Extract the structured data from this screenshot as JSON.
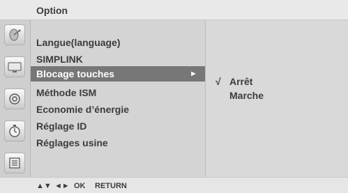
{
  "title": "Option",
  "menu": {
    "items": [
      {
        "label": "Langue(language)"
      },
      {
        "label": "SIMPLINK"
      },
      {
        "label": "Blocage touches",
        "selected": true,
        "arrow": "►"
      },
      {
        "label": "Méthode ISM"
      },
      {
        "label": "Economie d’énergie"
      },
      {
        "label": "Réglage ID"
      },
      {
        "label": "Réglages usine"
      }
    ]
  },
  "submenu": {
    "items": [
      {
        "check": "√",
        "label": "Arrêt"
      },
      {
        "check": "",
        "label": "Marche"
      }
    ]
  },
  "sidebar_icons": [
    {
      "name": "satellite-dish-icon"
    },
    {
      "name": "tv-screen-icon"
    },
    {
      "name": "speaker-icon"
    },
    {
      "name": "clock-icon"
    },
    {
      "name": "option-menu-icon"
    }
  ],
  "bottom": {
    "nav_arrows_ud": "▲▼",
    "nav_arrows_lr": "◄►",
    "ok_label": "OK",
    "return_label": "RETURN"
  },
  "colors": {
    "selected_bg": "#777777",
    "panel_bg": "#d4d4d4",
    "text": "#3c3c3c"
  }
}
